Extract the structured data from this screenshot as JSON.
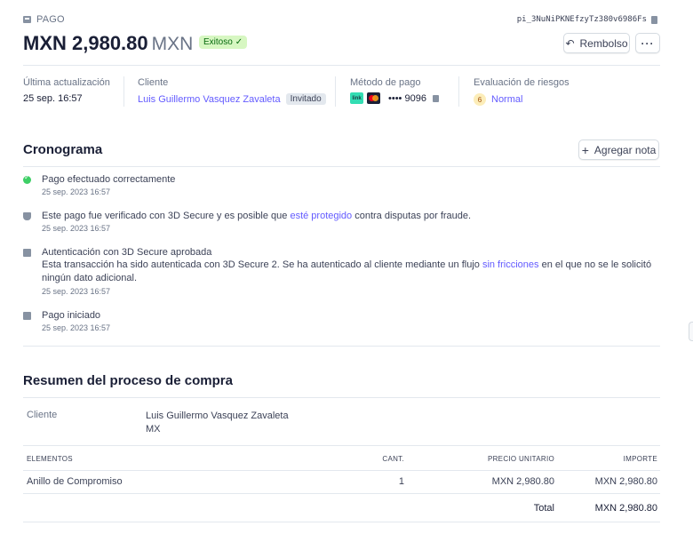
{
  "header": {
    "breadcrumb": "PAGO",
    "payment_id": "pi_3NuNiPKNEfzyTz380v6986Fs",
    "amount": "MXN 2,980.80",
    "currency": "MXN",
    "status_badge": "Exitoso",
    "refund_label": "Rembolso",
    "more_label": "···"
  },
  "details": {
    "last_update_label": "Última actualización",
    "last_update_value": "25 sep. 16:57",
    "customer_label": "Cliente",
    "customer_name": "Luis Guillermo Vasquez Zavaleta",
    "customer_tag": "Invitado",
    "payment_method_label": "Método de pago",
    "link_badge": "link",
    "card_last4": "•••• 9096",
    "risk_label": "Evaluación de riesgos",
    "risk_score": "6",
    "risk_value": "Normal"
  },
  "timeline": {
    "title": "Cronograma",
    "add_note_label": "Agregar nota",
    "events": [
      {
        "title": "Pago efectuado correctamente",
        "date": "25 sep. 2023 16:57"
      },
      {
        "title_before": "Este pago fue verificado con 3D Secure y es posible que ",
        "title_link": "esté protegido",
        "title_after": " contra disputas por fraude.",
        "date": "25 sep. 2023 16:57"
      },
      {
        "title": "Autenticación con 3D Secure aprobada",
        "desc_before": "Esta transacción ha sido autenticada con 3D Secure 2. Se ha autenticado al cliente mediante un flujo ",
        "desc_link": "sin fricciones",
        "desc_after": " en el que no se le solicitó ningún dato adicional.",
        "date": "25 sep. 2023 16:57"
      },
      {
        "title": "Pago iniciado",
        "date": "25 sep. 2023 16:57"
      }
    ]
  },
  "summary": {
    "title": "Resumen del proceso de compra",
    "customer_label": "Cliente",
    "customer_name": "Luis Guillermo Vasquez Zavaleta",
    "customer_country": "MX",
    "columns": {
      "items": "ELEMENTOS",
      "qty": "CANT.",
      "unit_price": "PRECIO UNITARIO",
      "amount": "IMPORTE"
    },
    "rows": [
      {
        "item": "Anillo de Compromiso",
        "qty": "1",
        "unit_price": "MXN 2,980.80",
        "amount": "MXN 2,980.80"
      }
    ],
    "total_label": "Total",
    "total_value": "MXN 2,980.80"
  }
}
